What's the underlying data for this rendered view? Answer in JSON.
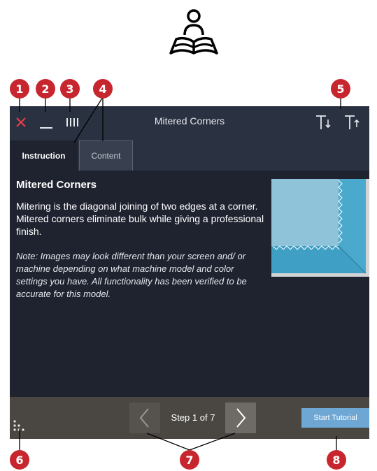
{
  "window": {
    "title": "Mitered Corners",
    "close_icon": "close-icon",
    "minimize_icon": "minimize-icon",
    "columns_icon": "columns-icon",
    "text_smaller_icon": "text-size-decrease-icon",
    "text_larger_icon": "text-size-increase-icon"
  },
  "tabs": [
    {
      "label": "Instruction",
      "active": true
    },
    {
      "label": "Content",
      "active": false
    }
  ],
  "content": {
    "heading": "Mitered Corners",
    "body": "Mitering is the diagonal joining of two edges at a corner. Mitered corners eliminate bulk while giving a professional finish.",
    "note": "Note: Images may look different than your screen and/ or machine depending on what machine model and color settings you have. All functionality has been verified to be accurate for this model."
  },
  "footer": {
    "step_label": "Step 1 of 7",
    "start_button_label": "Start Tutorial"
  },
  "callouts": [
    "1",
    "2",
    "3",
    "4",
    "5",
    "6",
    "7",
    "8"
  ],
  "colors": {
    "callout": "#c8262e",
    "window_bg": "#1f2330",
    "titlebar_bg": "#2a3141",
    "accent": "#e8404a",
    "start_button": "#6ea6d4",
    "footer_bg": "#4a4742"
  }
}
